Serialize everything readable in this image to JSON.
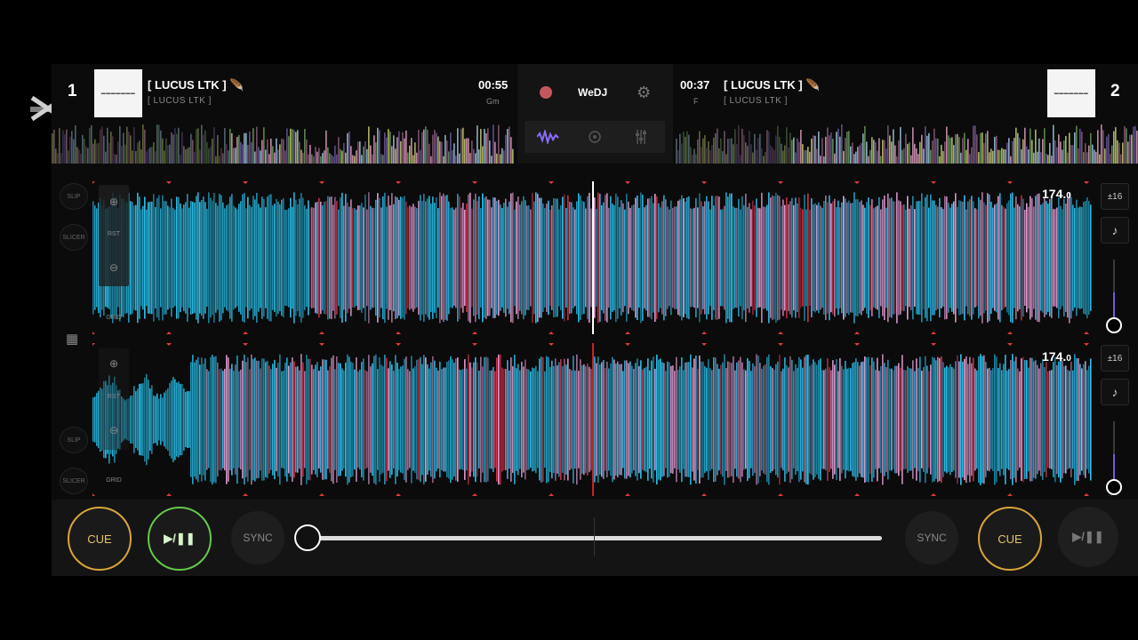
{
  "deck1": {
    "number": "1",
    "title": "[ LUCUS LTK ]",
    "artist": "[ LUCUS LTK ]",
    "time": "00:55",
    "key": "Gm",
    "bpm_main": "174.",
    "bpm_frac": "0",
    "range": "±16",
    "slip": "SLIP",
    "slicer": "SLICER",
    "rst": "RST",
    "grid": "GRID",
    "play_label": "▶/❚❚",
    "cue_label": "CUE",
    "sync_label": "SYNC",
    "pitch_level": 0.5
  },
  "deck2": {
    "number": "2",
    "title": "[ LUCUS LTK ]",
    "artist": "[ LUCUS LTK ]",
    "time": "00:37",
    "key": "F",
    "bpm_main": "174.",
    "bpm_frac": "0",
    "range": "±16",
    "slip": "SLIP",
    "slicer": "SLICER",
    "rst": "RST",
    "grid": "GRID",
    "play_label": "▶/❚❚",
    "cue_label": "CUE",
    "sync_label": "SYNC",
    "pitch_level": 0.5
  },
  "center": {
    "brand": "WeDJ",
    "record_icon": "record-dot-icon",
    "settings_icon": "gear-icon",
    "modes": [
      "waveform-icon",
      "jog-icon",
      "eq-icon"
    ]
  },
  "crossfader": {
    "position": 0.0
  },
  "colors": {
    "accent_cue": "#d8a53a",
    "accent_play": "#65c94a",
    "wave_cyan": "#2bc4f0",
    "wave_pink": "#e8a0d8",
    "wave_red": "#e0304a",
    "playhead_deck2": "#d02020"
  }
}
